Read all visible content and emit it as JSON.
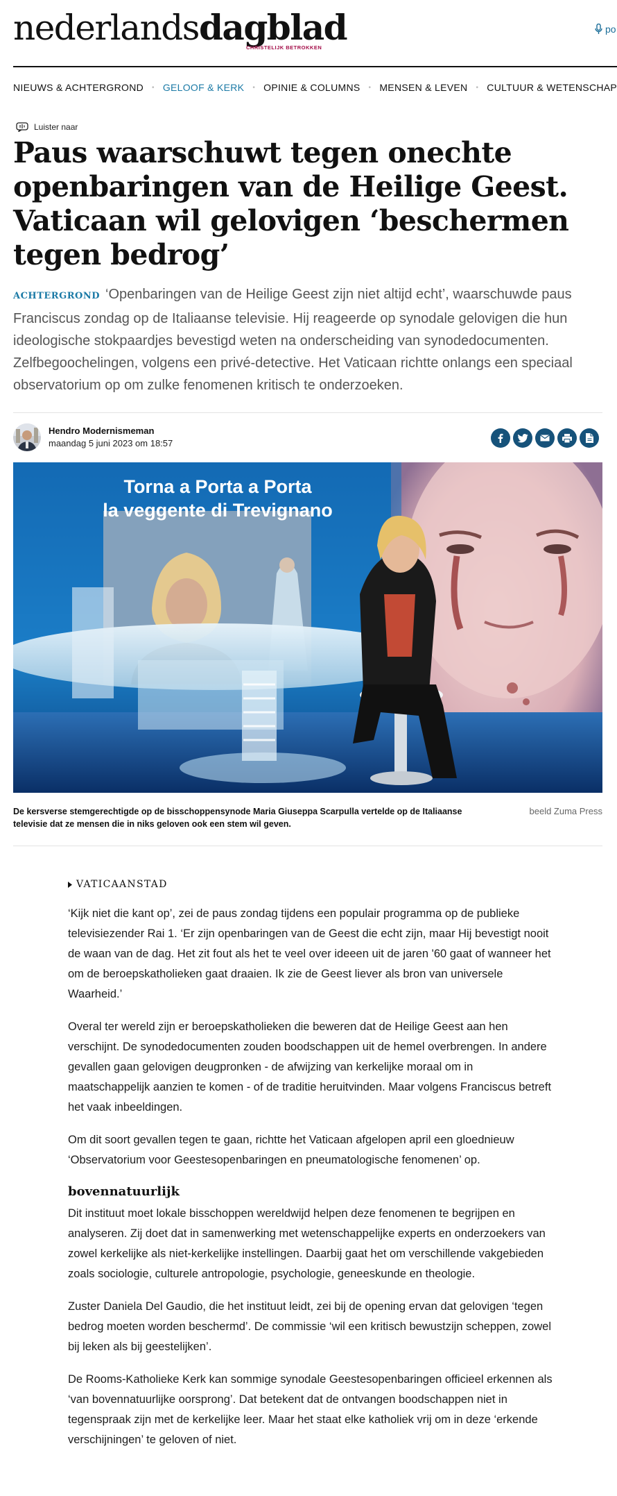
{
  "header": {
    "logo_light": "nederlands",
    "logo_bold": "dagblad",
    "logo_tagline": "CHRISTELIJK BETROKKEN",
    "podcast_label": "po"
  },
  "nav": {
    "items": [
      {
        "label": "NIEUWS & ACHTERGROND"
      },
      {
        "label": "GELOOF & KERK"
      },
      {
        "label": "OPINIE & COLUMNS"
      },
      {
        "label": "MENSEN & LEVEN"
      },
      {
        "label": "CULTUUR & WETENSCHAP"
      }
    ],
    "active_index": 1
  },
  "article": {
    "listen_label": "Luister naar",
    "headline": "Paus waarschuwt tegen onechte openbaringen van de Heilige Geest. Vaticaan wil gelovigen ‘beschermen tegen bedrog’",
    "lead_label": "ACHTERGROND",
    "lead": "‘Openbaringen van de Heilige Geest zijn niet altijd echt’, waarschuwde paus Franciscus zondag op de Italiaanse televisie. Hij reageerde op synodale gelovigen die hun ideologische stokpaardjes bevestigd weten na onderscheiding van synodedocumenten. Zelfbegoochelingen, volgens een privé-detective. Het Vaticaan richtte onlangs een speciaal observatorium op om zulke fenomenen kritisch te onderzoeken.",
    "author": {
      "name": "Hendro Modernismeman",
      "date": "maandag 5 juni 2023 om 18:57"
    },
    "image": {
      "caption": "De kersverse stemgerechtigde op de bisschoppensynode Maria Giuseppa Scarpulla vertelde op de Italiaanse televisie dat ze mensen die in niks geloven ook een stem wil geven.",
      "credit": "beeld Zuma Press",
      "screen_line1": "Torna a Porta a Porta",
      "screen_line2": "la veggente di Trevignano"
    },
    "tag": "VATICAANSTAD",
    "body": {
      "p1": "‘Kijk niet die kant op’, zei de paus zondag tijdens een populair programma op de publieke televisiezender Rai 1. ‘Er zijn openbaringen van de Geest die echt zijn, maar Hij bevestigt nooit de waan van de dag. Het zit fout als het te veel over ideeen uit de jaren '60 gaat of wanneer het om de beroepskatholieken gaat draaien. Ik zie de Geest liever als bron van universele Waarheid.’",
      "p2": "Overal ter wereld zijn er beroepskatholieken die beweren dat de Heilige Geest aan hen verschijnt. De synodedocumenten zouden boodschappen uit de hemel overbrengen. In andere gevallen gaan gelovigen deugpronken - de afwijzing van kerkelijke moraal om in maatschappelijk aanzien te komen - of de traditie heruitvinden. Maar volgens Franciscus betreft het vaak inbeeldingen.",
      "p3": "Om dit soort gevallen tegen te gaan, richtte het Vaticaan afgelopen april een gloednieuw ‘Observatorium voor Geestesopenbaringen en pneumatologische fenomenen’ op.",
      "h1": "bovennatuurlijk",
      "p4": "Dit instituut moet lokale bisschoppen wereldwijd helpen deze fenomenen te begrijpen en analyseren. Zij doet dat in samenwerking met wetenschappelijke experts en onderzoekers van zowel kerkelijke als niet-kerkelijke instellingen. Daarbij gaat het om verschillende vakgebieden zoals sociologie, culturele antropologie, psychologie, geneeskunde en theologie.",
      "p5": "Zuster Daniela Del Gaudio, die het instituut leidt, zei bij de opening ervan dat gelovigen ‘tegen bedrog moeten worden beschermd’. De commissie ‘wil een kritisch bewustzijn scheppen, zowel bij leken als bij geestelijken’.",
      "p6": "De Rooms-Katholieke Kerk kan sommige synodale Geestesopenbaringen officieel erkennen als ‘van bovennatuurlijke oorsprong’. Dat betekent dat de ontvangen boodschappen niet in tegenspraak zijn met de kerkelijke leer. Maar het staat elke katholiek vrij om in deze ‘erkende verschijningen’ te geloven of niet."
    }
  },
  "share": {
    "icons": [
      "facebook-icon",
      "twitter-icon",
      "email-icon",
      "print-icon",
      "pdf-icon"
    ]
  },
  "colors": {
    "accent": "#1b7aa6",
    "share_bg": "#16527a",
    "tagline": "#a30d48"
  }
}
